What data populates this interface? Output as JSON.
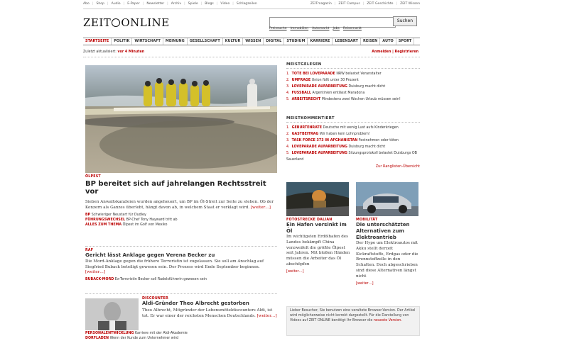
{
  "top_links_left": [
    "Abo",
    "Shop",
    "Audio",
    "E-Paper",
    "Newsletter",
    "Archiv",
    "Spiele",
    "Blogs",
    "Video",
    "Schlagzeilen"
  ],
  "top_links_right": [
    "ZEITmagazin",
    "ZEIT Campus",
    "ZEIT Geschichte",
    "ZEIT Wissen"
  ],
  "logo": {
    "left": "ZEIT",
    "right": "ONLINE"
  },
  "search": {
    "button": "Suchen",
    "value": ""
  },
  "search_links": [
    "Preissuche",
    "Immobilien",
    "Automarkt",
    "Jobs",
    "Reisemarkt"
  ],
  "main_nav": [
    {
      "label": "STARTSEITE",
      "active": true
    },
    {
      "label": "POLITIK",
      "active": false
    },
    {
      "label": "WIRTSCHAFT",
      "active": false
    },
    {
      "label": "MEINUNG",
      "active": false
    },
    {
      "label": "GESELLSCHAFT",
      "active": false
    },
    {
      "label": "KULTUR",
      "active": false
    },
    {
      "label": "WISSEN",
      "active": false
    },
    {
      "label": "DIGITAL",
      "active": false
    },
    {
      "label": "STUDIUM",
      "active": false
    },
    {
      "label": "KARRIERE",
      "active": false
    },
    {
      "label": "LEBENSART",
      "active": false
    },
    {
      "label": "REISEN",
      "active": false
    },
    {
      "label": "AUTO",
      "active": false
    },
    {
      "label": "SPORT",
      "active": false
    }
  ],
  "status": {
    "text": "Zuletzt aktualisiert:",
    "value": "vor 4 Minuten"
  },
  "auth": "Anmelden | Registrieren",
  "lead": {
    "kicker": "ÖLPEST",
    "title": "BP bereitet sich auf jahrelangen Rechtsstreit vor",
    "teaser": "Sieben Anwaltskanzleien wurden angeheuert, um BP im Öl-Streit zur Seite zu stehen. Ob der Konzern als Ganzes überlebt, hängt davon ab, in welchem Staat er verklagt wird.",
    "more": "[weiter…]",
    "related": [
      {
        "k": "BP",
        "t": "Schwieriger Neustart für Dudley"
      },
      {
        "k": "FÜHRUNGSWECHSEL",
        "t": "BP-Chef Tony Hayward tritt ab"
      },
      {
        "k": "ALLES ZUM THEMA",
        "t": "Ölpest im Golf von Mexiko"
      }
    ]
  },
  "raf": {
    "kicker": "RAF",
    "title": "Gericht lässt Anklage gegen Verena Becker zu",
    "teaser": "Die Mord-Anklage gegen die frühere Terroristin ist zugelassen. Sie soll am Anschlag auf Siegfried Buback beteiligt gewesen sein. Der Prozess wird Ende September beginnen.",
    "more": "[weiter…]",
    "related": [
      {
        "k": "BUBACK-MORD",
        "t": "Ex-Terroristin Becker soll Radelsführerin gewesen sein"
      }
    ]
  },
  "discounter": {
    "kicker": "DISCOUNTER",
    "title": "Aldi-Gründer Theo Albrecht gestorben",
    "teaser": "Theo Albrecht, Mitgründer der Lebensmitteldiscounters Aldi, ist tot. Er war einer der reichsten Menschen Deutschlands.",
    "more": "[weiter…]",
    "related": [
      {
        "k": "PERSONALENTWICKLUNG",
        "t": "Karriere mit der Aldi-Akademie"
      },
      {
        "k": "DORFLADEN",
        "t": "Wenn der Kunde zum Unternehmer wird"
      }
    ]
  },
  "meistgelesen": {
    "title": "MEISTGELESEN",
    "items": [
      {
        "k": "TOTE BEI LOVEPARADE",
        "t": "NRW belastet Veranstalter"
      },
      {
        "k": "UMFRAGE",
        "t": "Union fällt unter 30 Prozent"
      },
      {
        "k": "LOVEPARADE AUFARBEITUNG",
        "t": "Duisburg macht dicht"
      },
      {
        "k": "FUSSBALL",
        "t": "Argentinien entlässt Maradona"
      },
      {
        "k": "ARBEITSRECHT",
        "t": "Mindestens zwei Wochen Urlaub müssen sein!"
      }
    ]
  },
  "meistkommentiert": {
    "title": "MEISTKOMMENTIERT",
    "items": [
      {
        "k": "GEBURTENRATE",
        "t": "Deutsche mit wenig Lust aufs Kinderkriegen"
      },
      {
        "k": "GASTBEITRAG",
        "t": "Wir haben kein Lohnproblem!"
      },
      {
        "k": "TASK FORCE 373 IN AFGHANISTAN",
        "t": "Festnehmen oder töten"
      },
      {
        "k": "LOVEPARADE AUFARBEITUNG",
        "t": "Duisburg macht dicht"
      },
      {
        "k": "LOVEPARADE AUFARBEITUNG",
        "t": "Sitzungsprotokoll belastet Duisburgs OB Sauerland"
      }
    ],
    "more": "Zur Ranglisten-Übersicht"
  },
  "teaser_left": {
    "kicker": "FOTOSTRECKE DALIAN",
    "title": "Ein Hafen versinkt im Öl",
    "teaser": "Im wichtigsten Erdölhafen des Landes bekämpft China verzweifelt die größte Ölpest seit Jahren. Mit bloßen Händen müssen die Arbeiter das Öl abschöpfen",
    "more": "[weiter…]"
  },
  "teaser_right": {
    "kicker": "MOBILITÄT",
    "title": "Die unterschätzten Alternativen zum Elektroantrieb",
    "teaser": "Der Hype um Elektroautos mit Akku stellt derzeit Kickraftstoffe, Erdgas oder die Brennstoffzelle in den Schatten. Doch abgeschrieben sind diese Alternativen längst nicht",
    "more": "[weiter…]"
  },
  "browser_box": {
    "text": "Lieber Besucher, Sie benutzen eine veraltete Browser-Version. Der Artikel wird möglicherweise nicht korrekt dargestellt. Für die Darstellung von Videos auf ZEIT ONLINE benötigt Ihr Browser die",
    "link": "neueste Version."
  },
  "colors": {
    "accent": "#b00000"
  }
}
